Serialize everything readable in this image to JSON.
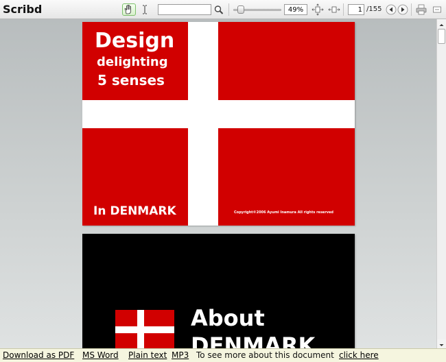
{
  "app": {
    "logo": "Scribd"
  },
  "toolbar": {
    "hand_tool_icon": "hand-icon",
    "text_tool_icon": "text-cursor-icon",
    "search": {
      "value": "",
      "placeholder": ""
    },
    "search_icon": "magnifier-icon",
    "zoom": {
      "value": "49%",
      "slider_fraction": 0.1
    },
    "page": {
      "current": "1",
      "total": "/155"
    },
    "accent": "#7cbf6a"
  },
  "document": {
    "pages": [
      {
        "background": "#d10000",
        "title": "Design",
        "subtitle_1": "delighting",
        "subtitle_2": "5 senses",
        "place": "In DENMARK",
        "copyright": "Copyright©2006 Ayumi Inamura All rights reserved"
      },
      {
        "background": "#000000",
        "heading_1": "About",
        "heading_2": "DENMARK"
      }
    ]
  },
  "footer": {
    "pdf": "Download as PDF",
    "word": "MS Word",
    "text": "Plain text",
    "mp3": "MP3",
    "more_text": "To see more about this document",
    "click_here": "click here"
  }
}
